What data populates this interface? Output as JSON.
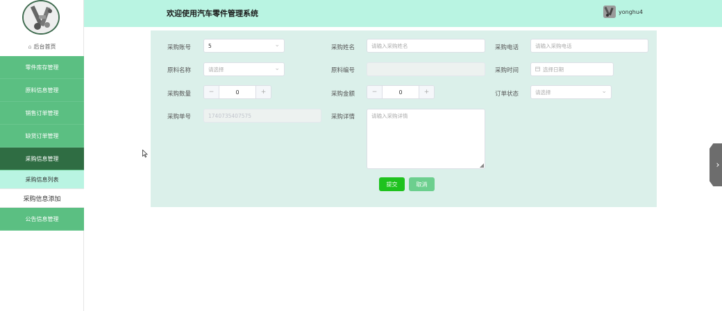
{
  "header": {
    "title": "欢迎使用汽车零件管理系统",
    "username": "yonghu4"
  },
  "sidebar": {
    "home_label": "后台首页",
    "items": [
      {
        "label": "零件库存管理"
      },
      {
        "label": "原料信息管理"
      },
      {
        "label": "销售订单管理"
      },
      {
        "label": "缺货订单管理"
      },
      {
        "label": "采购信息管理"
      }
    ],
    "submenu": [
      {
        "label": "采购信息列表"
      },
      {
        "label": "采购信息添加"
      }
    ],
    "bottom_item": {
      "label": "公告信息管理"
    }
  },
  "form": {
    "account_label": "采购账号",
    "account_value": "5",
    "name_label": "采购姓名",
    "name_placeholder": "请输入采购姓名",
    "phone_label": "采购电话",
    "phone_placeholder": "请输入采购电话",
    "material_label": "原料名称",
    "material_placeholder": "请选择",
    "material_no_label": "原料编号",
    "material_no_value": "",
    "time_label": "采购时间",
    "time_placeholder": "选择日期",
    "qty_label": "采购数量",
    "qty_value": "0",
    "amount_label": "采购金额",
    "amount_value": "0",
    "status_label": "订单状态",
    "status_placeholder": "请选择",
    "order_no_label": "采购单号",
    "order_no_value": "1740735407575",
    "detail_label": "采购详情",
    "detail_placeholder": "请输入采购详情",
    "submit_label": "提交",
    "cancel_label": "取消"
  },
  "icons": {
    "stepper_minus": "−",
    "stepper_plus": "+",
    "chevron": "⌄",
    "side_handle": "›",
    "home": "⌂"
  },
  "colors": {
    "header_bg": "#b9f4e2",
    "menu_bg": "#5bbf82",
    "menu_active": "#2f6d43",
    "panel_bg": "#dbf0ea",
    "submit": "#1ec21e",
    "cancel": "#6ccf8e"
  }
}
